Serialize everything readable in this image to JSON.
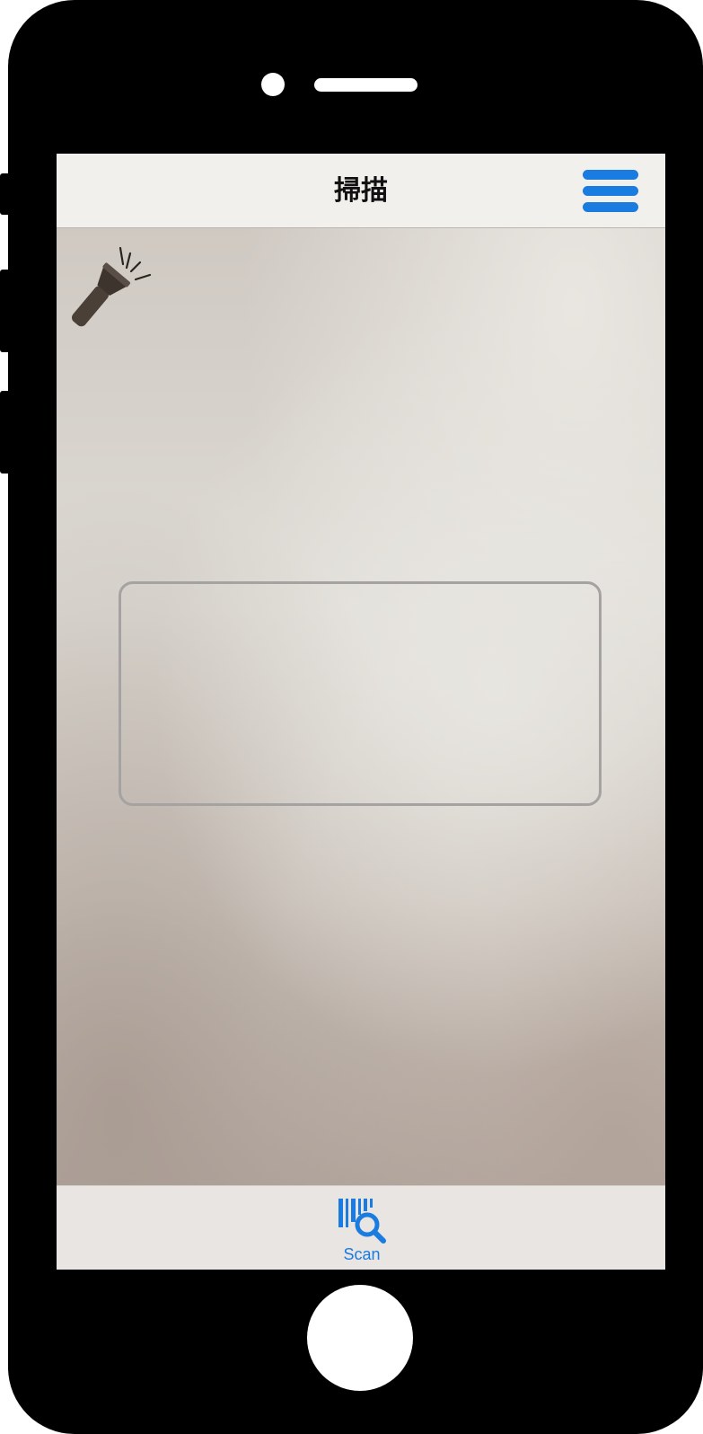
{
  "app": {
    "device_frame": "iphone",
    "accent_color": "#1a7be0"
  },
  "nav_bar": {
    "title": "掃描",
    "menu_icon": "hamburger-menu-icon"
  },
  "camera_view": {
    "flashlight_icon": "flashlight-icon",
    "scan_frame": "barcode-scan-frame"
  },
  "tab_bar": {
    "tabs": [
      {
        "label": "Scan",
        "icon": "barcode-search-icon",
        "selected": true
      }
    ]
  }
}
